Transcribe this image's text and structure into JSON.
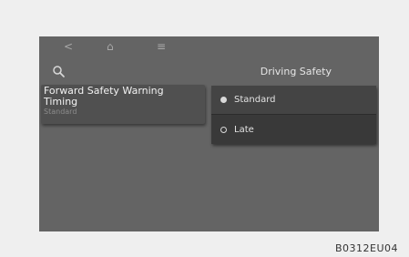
{
  "topbar": {
    "back_icon": "<",
    "home_icon": "⌂",
    "menu_icon": "≡"
  },
  "header": {
    "title": "Driving Safety"
  },
  "menu": {
    "item": {
      "title": "Forward Safety Warning Timing",
      "value": "Standard"
    }
  },
  "options": [
    {
      "label": "Standard",
      "selected": true
    },
    {
      "label": "Late",
      "selected": false
    }
  ],
  "caption": "B0312EU04",
  "colors": {
    "screen_bg": "#646464",
    "panel_bg": "#3a3a3a"
  }
}
